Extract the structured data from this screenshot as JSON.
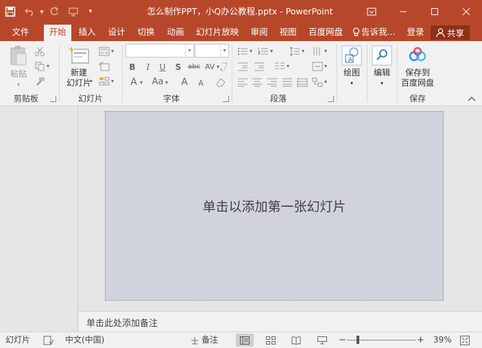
{
  "app": {
    "title": "怎么制作PPT，小Q办公教程.pptx - PowerPoint",
    "accent": "#b7472a"
  },
  "qat": {
    "save_icon": "save-icon",
    "undo_icon": "undo-icon",
    "redo_icon": "redo-icon",
    "present_icon": "start-presentation-icon",
    "customize_icon": "customize-qat-icon"
  },
  "tabs": [
    {
      "label": "文件",
      "active": false
    },
    {
      "label": "开始",
      "active": true
    },
    {
      "label": "插入",
      "active": false
    },
    {
      "label": "设计",
      "active": false
    },
    {
      "label": "切换",
      "active": false
    },
    {
      "label": "动画",
      "active": false
    },
    {
      "label": "幻灯片放映",
      "active": false
    },
    {
      "label": "审阅",
      "active": false
    },
    {
      "label": "视图",
      "active": false
    },
    {
      "label": "百度网盘",
      "active": false
    }
  ],
  "tellme": "告诉我...",
  "login": "登录",
  "share": "共享",
  "ribbon": {
    "clipboard": {
      "paste": "粘贴",
      "label": "剪贴板"
    },
    "slides": {
      "new_slide_line1": "新建",
      "new_slide_line2": "幻灯片",
      "label": "幻灯片"
    },
    "font": {
      "label": "字体",
      "font_name_value": "",
      "font_size_value": "",
      "bold": "B",
      "italic": "I",
      "underline": "U",
      "shadow": "S",
      "strike": "abc",
      "spacing": "AV",
      "font_color": "A",
      "change_case": "Aa",
      "grow": "A",
      "shrink": "A"
    },
    "paragraph": {
      "label": "段落"
    },
    "drawing": {
      "label": "绘图"
    },
    "editing": {
      "label": "编辑"
    },
    "save": {
      "line1": "保存到",
      "line2": "百度网盘",
      "label": "保存"
    }
  },
  "slide": {
    "placeholder": "单击以添加第一张幻灯片"
  },
  "notes": {
    "placeholder": "单击此处添加备注"
  },
  "status": {
    "slide": "幻灯片",
    "language": "中文(中国)",
    "notes": "备注",
    "zoom": "39%",
    "zoom_level": 0.39
  }
}
